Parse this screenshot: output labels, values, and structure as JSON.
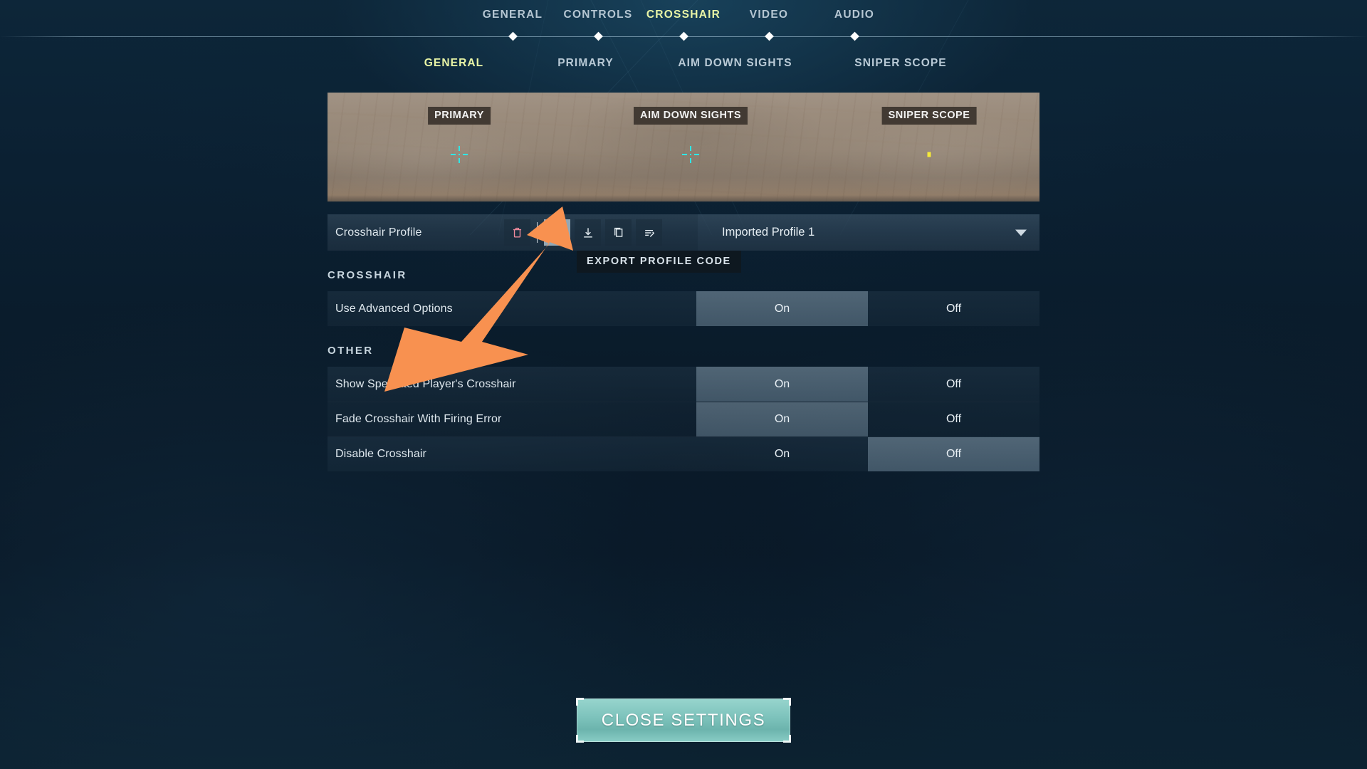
{
  "top_nav": {
    "items": [
      {
        "label": "GENERAL",
        "active": false
      },
      {
        "label": "CONTROLS",
        "active": false
      },
      {
        "label": "CROSSHAIR",
        "active": true
      },
      {
        "label": "VIDEO",
        "active": false
      },
      {
        "label": "AUDIO",
        "active": false
      }
    ]
  },
  "sub_nav": {
    "items": [
      {
        "label": "GENERAL",
        "active": true
      },
      {
        "label": "PRIMARY",
        "active": false
      },
      {
        "label": "AIM DOWN SIGHTS",
        "active": false
      },
      {
        "label": "SNIPER SCOPE",
        "active": false
      }
    ]
  },
  "preview": {
    "labels": [
      {
        "text": "PRIMARY",
        "crosshair": "cyan-cross"
      },
      {
        "text": "AIM DOWN SIGHTS",
        "crosshair": "cyan-cross"
      },
      {
        "text": "SNIPER SCOPE",
        "crosshair": "yellow-dot"
      }
    ],
    "crosshair_color": "#2ee7e7",
    "sniper_dot_color": "#f5e93a"
  },
  "profile": {
    "label": "Crosshair Profile",
    "selected": "Imported Profile 1",
    "tooltip": "EXPORT PROFILE CODE",
    "actions": [
      {
        "name": "delete-profile",
        "icon": "trash-icon",
        "state": "danger"
      },
      {
        "name": "export-profile-code",
        "icon": "upload-icon",
        "state": "highlight"
      },
      {
        "name": "import-profile-code",
        "icon": "download-icon",
        "state": "normal"
      },
      {
        "name": "duplicate-profile",
        "icon": "copy-icon",
        "state": "normal"
      },
      {
        "name": "rename-profile",
        "icon": "rename-icon",
        "state": "normal"
      }
    ]
  },
  "sections": [
    {
      "heading": "CROSSHAIR",
      "rows": [
        {
          "label": "Use Advanced Options",
          "options": [
            "On",
            "Off"
          ],
          "selected": 0
        }
      ]
    },
    {
      "heading": "OTHER",
      "rows": [
        {
          "label": "Show Spectated Player's Crosshair",
          "options": [
            "On",
            "Off"
          ],
          "selected": 0
        },
        {
          "label": "Fade Crosshair With Firing Error",
          "options": [
            "On",
            "Off"
          ],
          "selected": 0
        },
        {
          "label": "Disable Crosshair",
          "options": [
            "On",
            "Off"
          ],
          "selected": 1
        }
      ]
    }
  ],
  "footer": {
    "close_label": "CLOSE SETTINGS"
  },
  "annotation": {
    "arrow_color": "#F89150",
    "points_to": "export-profile-code"
  },
  "colors": {
    "accent_active": "#e9f5a6",
    "text_primary": "#dfe8ee",
    "danger": "#f08a9c",
    "close_button": "#7cc2bb"
  }
}
